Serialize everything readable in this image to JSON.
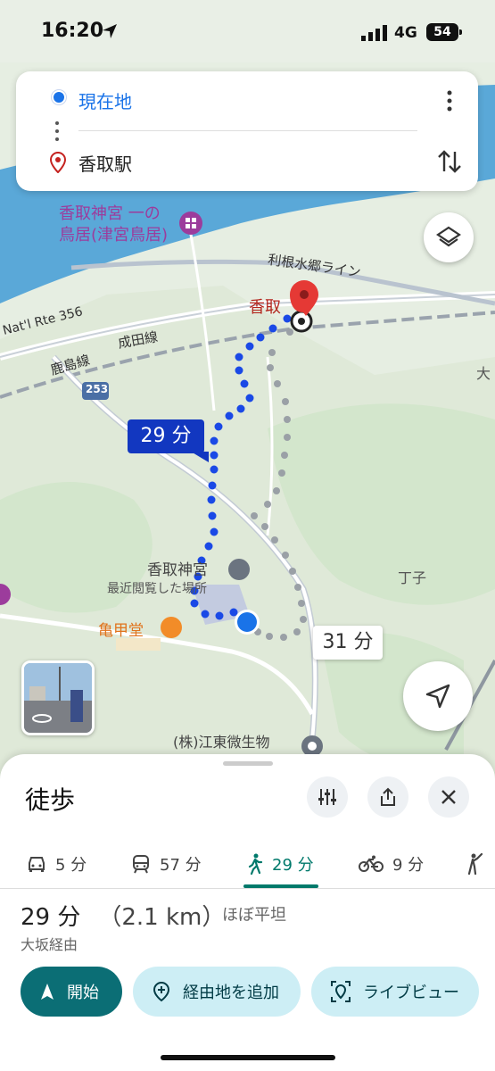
{
  "status_bar": {
    "time": "16:20",
    "network": "4G",
    "battery": "54"
  },
  "route": {
    "origin": "現在地",
    "destination": "香取駅"
  },
  "map": {
    "labels": {
      "shrine_gate": "香取神宮 一の鳥居(津宮鳥居)",
      "shrine_gate_line1": "香取神宮 一の",
      "shrine_gate_line2": "鳥居(津宮鳥居)",
      "tone_line": "利根水郷ライン",
      "station": "香取",
      "rte356": "Nat'l Rte 356",
      "kashima_line": "鹿島線",
      "narita_line": "成田線",
      "route253": "253",
      "katori_jingu": "香取神宮",
      "recently_viewed": "最近閲覧した場所",
      "kikkodo": "亀甲堂",
      "choshi": "丁子",
      "koto_bio": "(株)江東微生物",
      "osaka_edge": "大"
    },
    "route_badge_primary": "29 分",
    "route_badge_alt": "31 分",
    "colors": {
      "route": "#1a49e6",
      "alt_route": "#9aa0a6",
      "river": "#5aa8d8"
    }
  },
  "sheet": {
    "title": "徒歩",
    "modes": [
      {
        "icon": "car-icon",
        "label": "5 分"
      },
      {
        "icon": "train-icon",
        "label": "57 分"
      },
      {
        "icon": "walk-icon",
        "label": "29 分",
        "active": true
      },
      {
        "icon": "bike-icon",
        "label": "9 分"
      },
      {
        "icon": "ride-icon",
        "label": ""
      }
    ],
    "summary": {
      "duration": "29 分",
      "distance": "（2.1 km）",
      "terrain": "ほぼ平坦"
    },
    "via": "大坂経由",
    "actions": {
      "start": "開始",
      "add_stop": "経由地を追加",
      "live_view": "ライブビュー"
    }
  }
}
